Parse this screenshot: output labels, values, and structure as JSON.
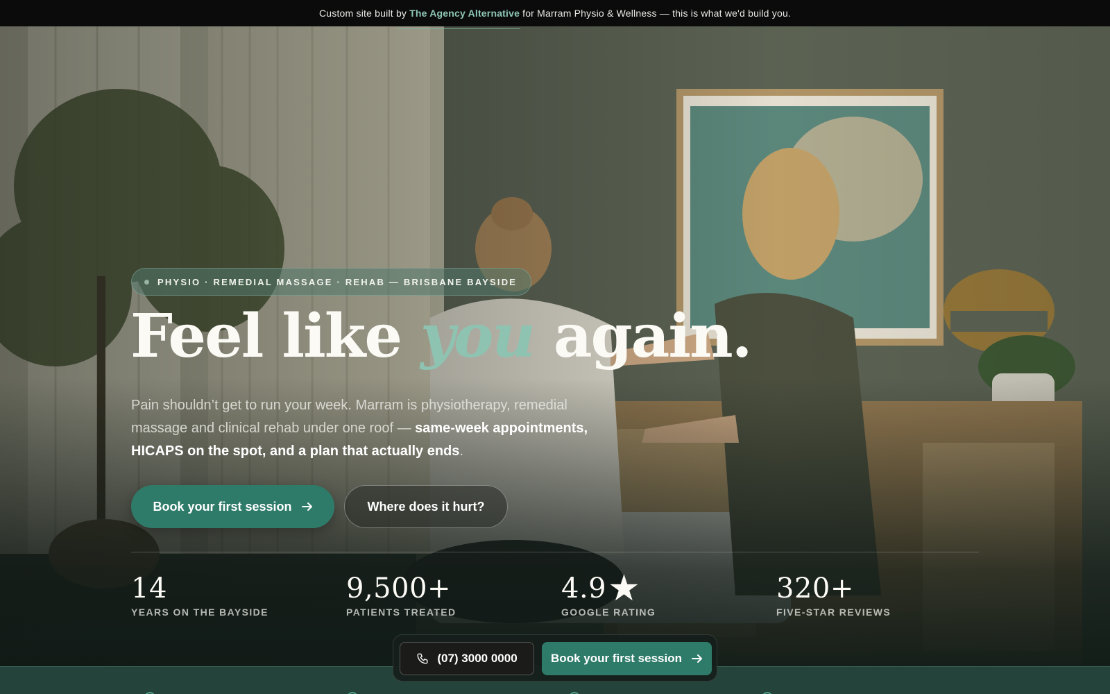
{
  "banner": {
    "prefix": "Custom site built by",
    "agency": "The Agency Alternative",
    "suffix": "for Marram Physio & Wellness — this is what we'd build you."
  },
  "hero": {
    "eyebrow": "PHYSIO · REMEDIAL MASSAGE · REHAB — BRISBANE BAYSIDE",
    "headline_part1": "Feel like",
    "headline_accent": "you",
    "headline_part2": "again.",
    "sub_plain": "Pain shouldn’t get to run your week. Marram is physiotherapy, remedial massage and clinical rehab under one roof —",
    "sub_bold": "same-week appointments, HICAPS on the spot, and a plan that actually ends",
    "sub_end": ".",
    "cta_primary": "Book your first session",
    "cta_secondary": "Where does it hurt?"
  },
  "stats": [
    {
      "value": "14",
      "label": "YEARS ON THE BAYSIDE"
    },
    {
      "value": "9,500+",
      "label": "PATIENTS TREATED"
    },
    {
      "value": "4.9",
      "star": "★",
      "label": "GOOGLE RATING"
    },
    {
      "value": "320+",
      "label": "FIVE-STAR REVIEWS"
    }
  ],
  "sticky": {
    "phone": "(07) 3000 0000",
    "book": "Book your first session"
  },
  "colors": {
    "accent": "#2f7b6a",
    "accent_text": "#8ec3b1",
    "banner_bg": "#0b0b0b"
  },
  "icons": [
    "arrow-right-icon",
    "phone-icon"
  ]
}
